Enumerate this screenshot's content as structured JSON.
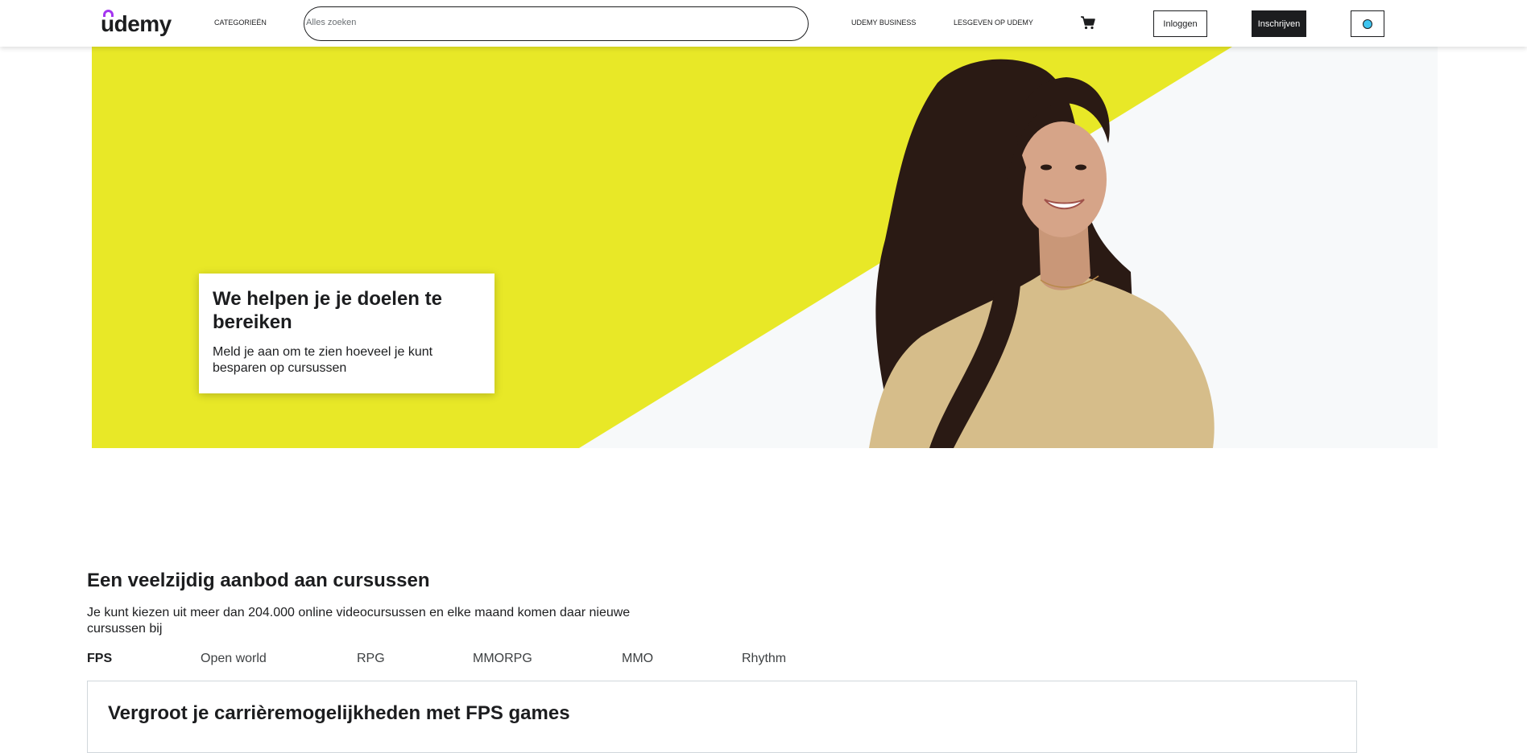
{
  "header": {
    "logo": "udemy",
    "categories_label": "CATEGORIEËN",
    "search_placeholder": "Alles zoeken",
    "business_label": "UDEMY BUSINESS",
    "teach_label": "LESGEVEN OP UDEMY",
    "cart_icon": "cart-icon",
    "login_label": "Inloggen",
    "signup_label": "Inschrijven",
    "language_icon": "globe-icon"
  },
  "hero": {
    "title": "We helpen je je doelen te bereiken",
    "subtitle": "Meld je aan om te zien hoeveel je kunt besparen op cursussen",
    "colors": {
      "yellow": "#e8e827",
      "background": "#f7f9fa",
      "blouse": "#d6bd8a"
    }
  },
  "courses": {
    "title": "Een veelzijdig aanbod aan cursussen",
    "subtitle": "Je kunt kiezen uit meer dan 204.000 online videocursussen en elke maand komen daar nieuwe cursussen bij",
    "tabs": [
      {
        "label": "FPS",
        "active": true
      },
      {
        "label": "Open world",
        "active": false
      },
      {
        "label": "RPG",
        "active": false
      },
      {
        "label": "MMORPG",
        "active": false
      },
      {
        "label": "MMO",
        "active": false
      },
      {
        "label": "Rhythm",
        "active": false
      }
    ],
    "box_title": "Vergroot je carrièremogelijkheden met FPS games"
  }
}
